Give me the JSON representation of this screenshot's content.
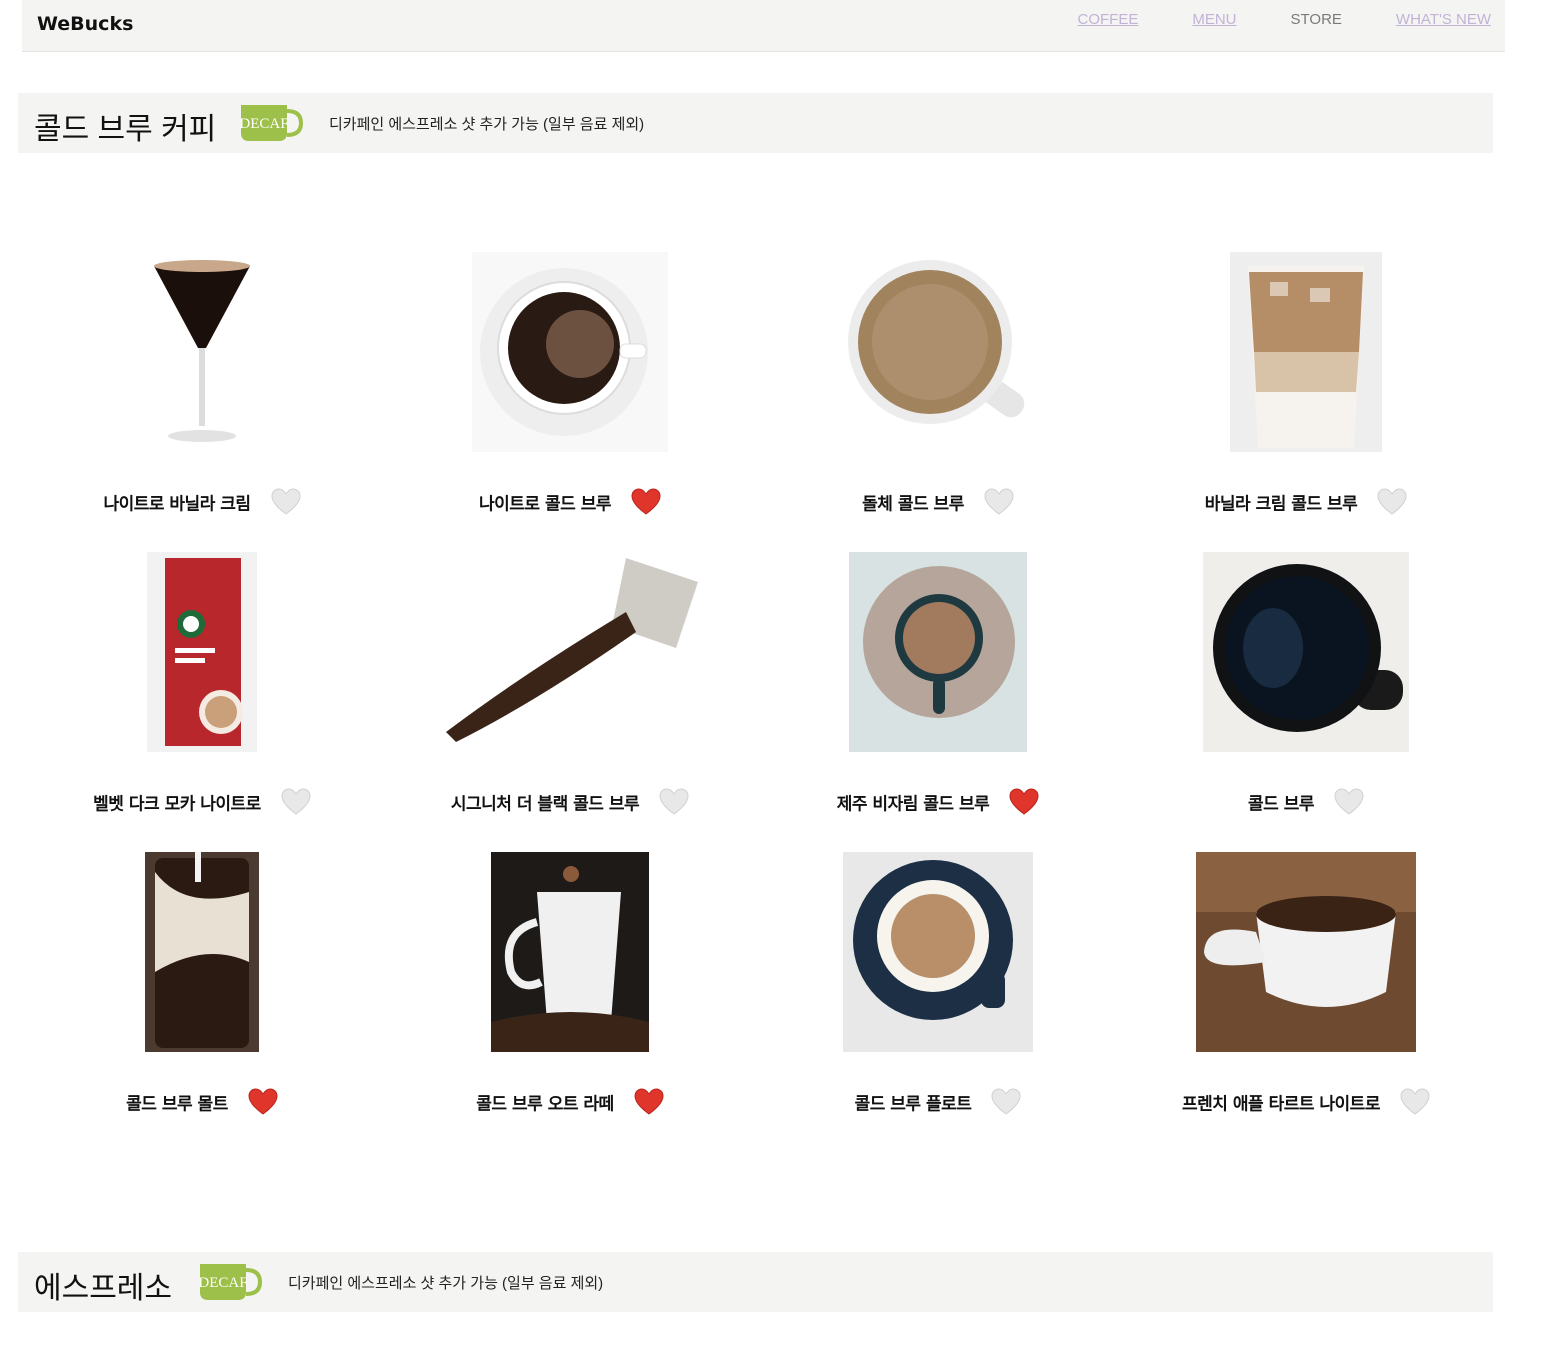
{
  "nav": {
    "brand": "WeBucks",
    "links": [
      "COFFEE",
      "MENU",
      "STORE",
      "WHAT'S NEW"
    ]
  },
  "sections": [
    {
      "title": "콜드 브루 커피",
      "badge": "DECAF",
      "note": "디카페인 에스프레소 샷 추가 가능 (일부 음료 제외)"
    },
    {
      "title": "에스프레소",
      "badge": "DECAF",
      "note": "디카페인 에스프레소 샷 추가 가능 (일부 음료 제외)"
    }
  ],
  "products": [
    {
      "name": "나이트로 바닐라 크림",
      "liked": false,
      "image": "espresso-martini-glass"
    },
    {
      "name": "나이트로 콜드 브루",
      "liked": true,
      "image": "black-coffee-cup-saucer"
    },
    {
      "name": "돌체 콜드 브루",
      "liked": false,
      "image": "latte-cup-top-view"
    },
    {
      "name": "바닐라 크림 콜드 브루",
      "liked": false,
      "image": "iced-latte-cup"
    },
    {
      "name": "벨벳 다크 모카 나이트로",
      "liked": false,
      "image": "toffee-nut-latte-box"
    },
    {
      "name": "시그니처 더 블랙 콜드 브루",
      "liked": false,
      "image": "spilled-coffee-beans-mug"
    },
    {
      "name": "제주 비자림 콜드 브루",
      "liked": true,
      "image": "coffee-cup-saucer-teal"
    },
    {
      "name": "콜드 브루",
      "liked": false,
      "image": "black-coffee-dark-mug"
    },
    {
      "name": "콜드 브루 몰트",
      "liked": true,
      "image": "iced-coffee-milk-glass"
    },
    {
      "name": "콜드 브루 오트 라떼",
      "liked": true,
      "image": "white-mug-splash-beans"
    },
    {
      "name": "콜드 브루 플로트",
      "liked": false,
      "image": "espresso-navy-cup"
    },
    {
      "name": "프렌치 애플 타르트 나이트로",
      "liked": false,
      "image": "cup-of-coffee-beans"
    }
  ],
  "colors": {
    "bar_bg": "#f4f4f2",
    "nav_link": "#c2b3d6",
    "heart_liked": "#e0352b",
    "heart_unliked": "#e8e8e8",
    "decaf_green": "#9cc04a"
  }
}
